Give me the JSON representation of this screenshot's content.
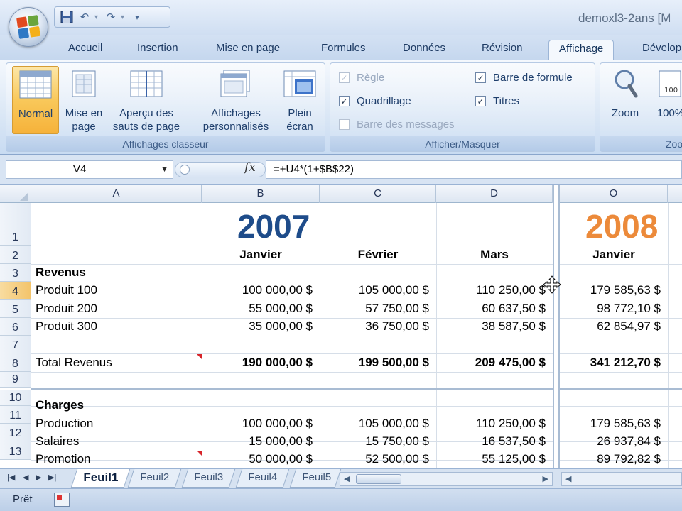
{
  "window": {
    "title": "demoxl3-2ans  [M"
  },
  "ribbon_tabs": [
    "Accueil",
    "Insertion",
    "Mise en page",
    "Formules",
    "Données",
    "Révision",
    "Affichage",
    "Dévelop"
  ],
  "ribbon_groups": {
    "classeur": {
      "label": "Affichages classeur",
      "normal": "Normal",
      "mise_en_page": [
        "Mise en",
        "page"
      ],
      "apercu": [
        "Aperçu des",
        "sauts de page"
      ],
      "perso": [
        "Affichages",
        "personnalisés"
      ],
      "plein": [
        "Plein",
        "écran"
      ]
    },
    "afficher": {
      "label": "Afficher/Masquer",
      "regle": "Règle",
      "quadrillage": "Quadrillage",
      "barre_messages": "Barre des messages",
      "barre_formule": "Barre de formule",
      "titres": "Titres"
    },
    "zoom": {
      "label": "Zoo",
      "zoom": "Zoom",
      "pct": "100%"
    }
  },
  "formula_bar": {
    "name_box": "V4",
    "fx": "fx",
    "formula": "=+U4*(1+$B$22)"
  },
  "columns": [
    "A",
    "B",
    "C",
    "D",
    "O"
  ],
  "rows": [
    "1",
    "2",
    "3",
    "4",
    "5",
    "6",
    "7",
    "8",
    "9",
    "10",
    "11",
    "12",
    "13"
  ],
  "cells": {
    "year_2007": "2007",
    "year_2008": "2008",
    "h_b": "Janvier",
    "h_c": "Février",
    "h_d": "Mars",
    "h_o": "Janvier",
    "revenus": "Revenus",
    "p100": "Produit 100",
    "p200": "Produit 200",
    "p300": "Produit 300",
    "total": "Total Revenus",
    "charges": "Charges",
    "production": "Production",
    "salaires": "Salaires",
    "promotion": "Promotion",
    "r4": [
      "100 000,00 $",
      "105 000,00 $",
      "110 250,00 $",
      "179 585,63 $"
    ],
    "r5": [
      "55 000,00 $",
      "57 750,00 $",
      "60 637,50 $",
      "98 772,10 $"
    ],
    "r6": [
      "35 000,00 $",
      "36 750,00 $",
      "38 587,50 $",
      "62 854,97 $"
    ],
    "r8": [
      "190 000,00 $",
      "199 500,00 $",
      "209 475,00 $",
      "341 212,70 $"
    ],
    "r11": [
      "100 000,00 $",
      "105 000,00 $",
      "110 250,00 $",
      "179 585,63 $"
    ],
    "r12": [
      "15 000,00 $",
      "15 750,00 $",
      "16 537,50 $",
      "26 937,84 $"
    ],
    "r13": [
      "50 000,00 $",
      "52 500,00 $",
      "55 125,00 $",
      "89 792,82 $"
    ]
  },
  "sheets": [
    "Feuil1",
    "Feuil2",
    "Feuil3",
    "Feuil4",
    "Feuil5"
  ],
  "status": {
    "text": "Prêt"
  },
  "colors": {
    "year_2007": "#1e4c8a",
    "year_2008": "#ec8a3a",
    "selection": "#f6c46a",
    "accent": "#f9c85a"
  }
}
